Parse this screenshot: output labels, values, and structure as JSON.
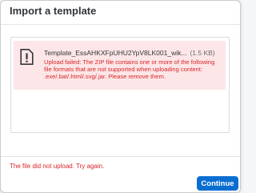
{
  "dialog": {
    "title": "Import a template"
  },
  "upload_item": {
    "icon": "file-error-icon",
    "file_name": "Template_EssAHKXFpUHU2YpV8LK001_wik...",
    "file_size": "(1.5 KB)",
    "error_message": "Upload failed: The ZIP file contains one or more of the following file formats that are not supported when uploading content: .exe/.bat/.html/.svg/.jar. Please remove them."
  },
  "footer": {
    "error_text": "The file did not upload. Try again.",
    "continue_label": "Continue"
  },
  "colors": {
    "accent": "#0a6ed1",
    "error": "#d7262a",
    "error_background": "#fde6e7"
  }
}
